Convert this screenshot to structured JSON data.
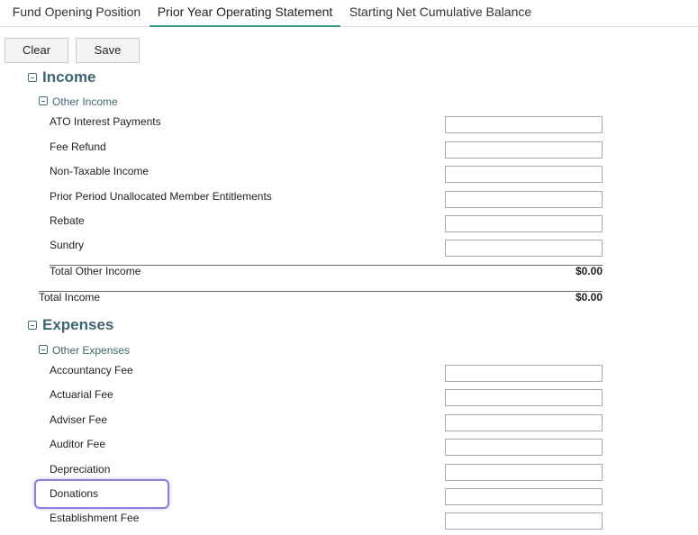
{
  "tabs": [
    {
      "label": "Fund Opening Position"
    },
    {
      "label": "Prior Year Operating Statement",
      "active": true
    },
    {
      "label": "Starting Net Cumulative Balance"
    }
  ],
  "toolbar": {
    "clear_label": "Clear",
    "save_label": "Save"
  },
  "income": {
    "title": "Income",
    "other": {
      "title": "Other Income",
      "items": [
        {
          "label": "ATO Interest Payments",
          "value": ""
        },
        {
          "label": "Fee Refund",
          "value": ""
        },
        {
          "label": "Non-Taxable Income",
          "value": ""
        },
        {
          "label": "Prior Period Unallocated Member Entitlements",
          "value": ""
        },
        {
          "label": "Rebate",
          "value": ""
        },
        {
          "label": "Sundry",
          "value": ""
        }
      ],
      "total_label": "Total Other Income",
      "total_value": "$0.00"
    },
    "total_label": "Total Income",
    "total_value": "$0.00"
  },
  "expenses": {
    "title": "Expenses",
    "other": {
      "title": "Other Expenses",
      "items": [
        {
          "label": "Accountancy Fee",
          "value": ""
        },
        {
          "label": "Actuarial Fee",
          "value": ""
        },
        {
          "label": "Adviser Fee",
          "value": ""
        },
        {
          "label": "Auditor Fee",
          "value": ""
        },
        {
          "label": "Depreciation",
          "value": ""
        },
        {
          "label": "Donations",
          "value": ""
        },
        {
          "label": "Establishment Fee",
          "value": ""
        }
      ]
    }
  },
  "colors": {
    "accent": "#3a9a8c",
    "section_title": "#3f6670",
    "highlight": "#8d7cdc"
  }
}
